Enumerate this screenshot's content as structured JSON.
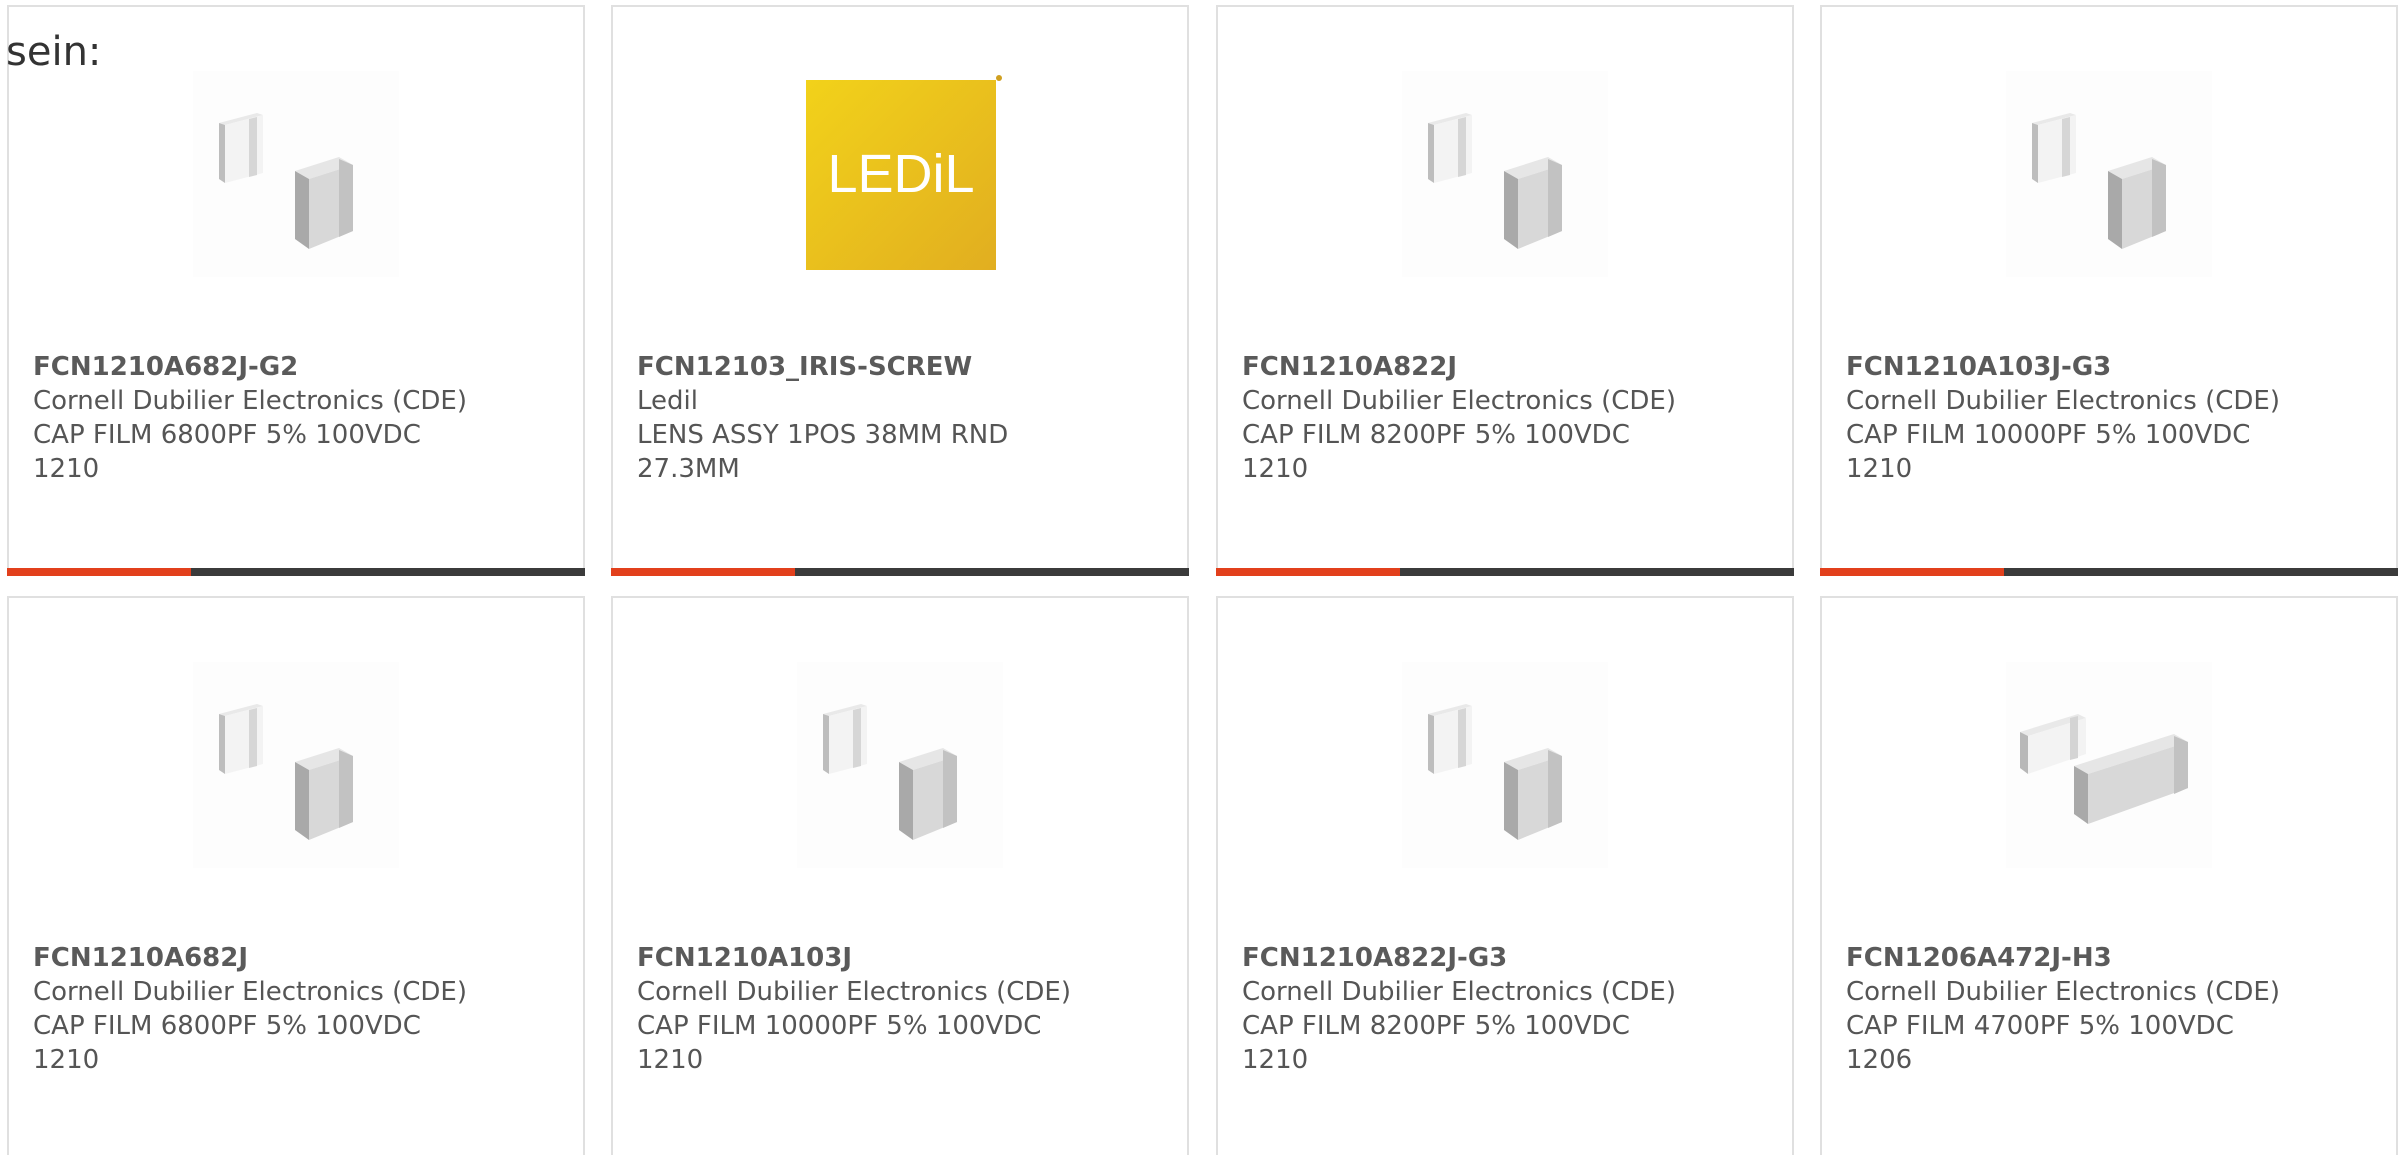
{
  "intro_text": "sein:",
  "accent_color": "#e2401c",
  "bar_color": "#3b3b3b",
  "products": [
    {
      "part_number": "FCN1210A682J-G2",
      "manufacturer": "Cornell Dubilier Electronics (CDE)",
      "desc_line1": "CAP FILM 6800PF 5% 100VDC",
      "desc_line2": "1210",
      "image": "chip-capacitor-icon"
    },
    {
      "part_number": "FCN12103_IRIS-SCREW",
      "manufacturer": "Ledil",
      "desc_line1": "LENS ASSY 1POS 38MM RND",
      "desc_line2": "27.3MM",
      "image": "ledil-logo",
      "logo_text": "LEDiL"
    },
    {
      "part_number": "FCN1210A822J",
      "manufacturer": "Cornell Dubilier Electronics (CDE)",
      "desc_line1": "CAP FILM 8200PF 5% 100VDC",
      "desc_line2": "1210",
      "image": "chip-capacitor-icon"
    },
    {
      "part_number": "FCN1210A103J-G3",
      "manufacturer": "Cornell Dubilier Electronics (CDE)",
      "desc_line1": "CAP FILM 10000PF 5% 100VDC",
      "desc_line2": "1210",
      "image": "chip-capacitor-icon"
    },
    {
      "part_number": "FCN1210A682J",
      "manufacturer": "Cornell Dubilier Electronics (CDE)",
      "desc_line1": "CAP FILM 6800PF 5% 100VDC",
      "desc_line2": "1210",
      "image": "chip-capacitor-icon"
    },
    {
      "part_number": "FCN1210A103J",
      "manufacturer": "Cornell Dubilier Electronics (CDE)",
      "desc_line1": "CAP FILM 10000PF 5% 100VDC",
      "desc_line2": "1210",
      "image": "chip-capacitor-icon"
    },
    {
      "part_number": "FCN1210A822J-G3",
      "manufacturer": "Cornell Dubilier Electronics (CDE)",
      "desc_line1": "CAP FILM 8200PF 5% 100VDC",
      "desc_line2": "1210",
      "image": "chip-capacitor-icon"
    },
    {
      "part_number": "FCN1206A472J-H3",
      "manufacturer": "Cornell Dubilier Electronics (CDE)",
      "desc_line1": "CAP FILM 4700PF 5% 100VDC",
      "desc_line2": "1206",
      "image": "chip-capacitor-long-icon"
    }
  ]
}
